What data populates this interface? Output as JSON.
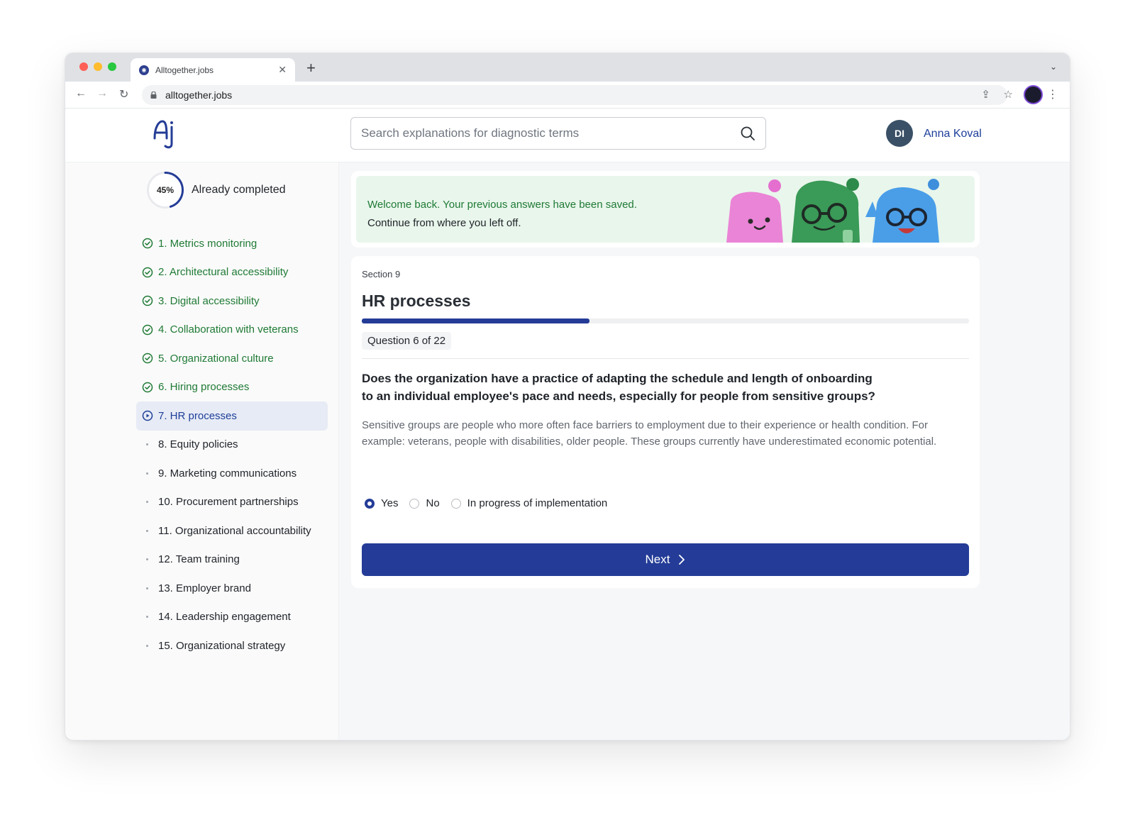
{
  "browser": {
    "tab_title": "Alltogether.jobs",
    "url": "alltogether.jobs"
  },
  "header": {
    "search_placeholder": "Search explanations for diagnostic terms",
    "user_initials": "DI",
    "user_name": "Anna Koval"
  },
  "sidebar": {
    "progress_value": "45%",
    "progress_fraction": 0.45,
    "progress_label": "Already completed",
    "sections": [
      {
        "label": "1. Metrics monitoring",
        "status": "done"
      },
      {
        "label": "2. Architectural accessibility",
        "status": "done"
      },
      {
        "label": "3. Digital accessibility",
        "status": "done"
      },
      {
        "label": "4. Collaboration with veterans",
        "status": "done"
      },
      {
        "label": "5. Organizational culture",
        "status": "done"
      },
      {
        "label": "6. Hiring processes",
        "status": "done"
      },
      {
        "label": "7. HR processes",
        "status": "current"
      },
      {
        "label": "8. Equity policies",
        "status": "todo"
      },
      {
        "label": "9. Marketing communications",
        "status": "todo"
      },
      {
        "label": "10. Procurement partnerships",
        "status": "todo"
      },
      {
        "label": "11. Organizational accountability",
        "status": "todo"
      },
      {
        "label": "12. Team training",
        "status": "todo"
      },
      {
        "label": "13. Employer brand",
        "status": "todo"
      },
      {
        "label": "14. Leadership engagement",
        "status": "todo"
      },
      {
        "label": "15. Organizational strategy",
        "status": "todo"
      }
    ]
  },
  "banner": {
    "line1": "Welcome back. Your previous answers have been saved.",
    "line2": "Continue from where you left off."
  },
  "question": {
    "section_number": "Section 9",
    "section_title": "HR processes",
    "progress_fraction": 0.375,
    "counter": "Question 6 of 22",
    "text": "Does the organization have a practice of adapting the schedule and length of onboarding to an individual employee's pace and needs, especially for people from sensitive groups?",
    "description": "Sensitive groups are people who more often face barriers to employment due to their experience or health condition. For example: veterans, people with disabilities, older people. These groups currently have underestimated economic potential.",
    "options": [
      {
        "label": "Yes",
        "selected": true
      },
      {
        "label": "No",
        "selected": false
      },
      {
        "label": "In progress of implementation",
        "selected": false
      }
    ],
    "next_label": "Next"
  },
  "colors": {
    "brand_blue": "#243c97",
    "done_green": "#1f7a35",
    "banner_bg": "#e9f6ec"
  }
}
